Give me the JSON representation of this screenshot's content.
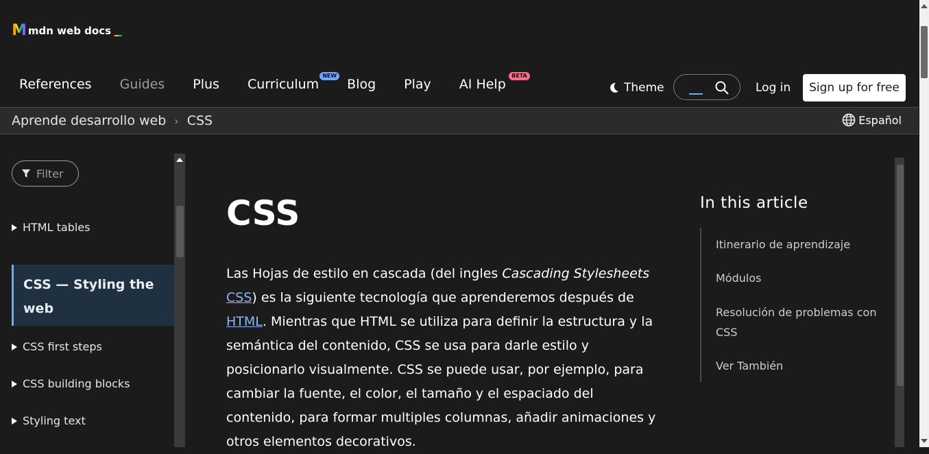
{
  "header": {
    "logo_mark": "M",
    "logo_text": "mdn web docs",
    "nav": [
      "References",
      "Guides",
      "Plus",
      "Curriculum",
      "Blog",
      "Play",
      "AI Help"
    ],
    "badges": {
      "curriculum": "NEW",
      "ai_help": "BETA"
    },
    "theme_label": "Theme",
    "login_label": "Log in",
    "signup_label": "Sign up for free"
  },
  "breadcrumb": {
    "items": [
      "Aprende desarrollo web",
      "CSS"
    ],
    "separator": "›",
    "language": "Español"
  },
  "sidebar": {
    "filter_placeholder": "Filter",
    "items": [
      "HTML tables",
      "CSS — Styling the web",
      "CSS first steps",
      "CSS building blocks",
      "Styling text"
    ]
  },
  "main": {
    "title": "CSS",
    "para_1": "Las Hojas de estilo en cascada (del ingles ",
    "para_em": "Cascading Stylesheets",
    "para_link1": "CSS",
    "para_2": ") es la siguiente tecnología que aprenderemos después de ",
    "para_link2": "HTML",
    "para_3": ". Mientras que HTML se utiliza para definir la estructura y la semántica del contenido, CSS se usa para darle estilo y posicionarlo visualmente. CSS se puede usar, por ejemplo, para cambiar la fuente, el color, el tamaño y el espaciado del contenido, para formar multiples columnas, añadir animaciones y otros elementos decorativos."
  },
  "toc": {
    "title": "In this article",
    "items": [
      "Itinerario de aprendizaje",
      "Módulos",
      "Resolución de problemas con CSS",
      "Ver También"
    ]
  },
  "colors": {
    "background": "#1b1b1b",
    "link": "#8cb4ff",
    "active_bg": "#1f3140",
    "accent": "#6ea8ff"
  }
}
